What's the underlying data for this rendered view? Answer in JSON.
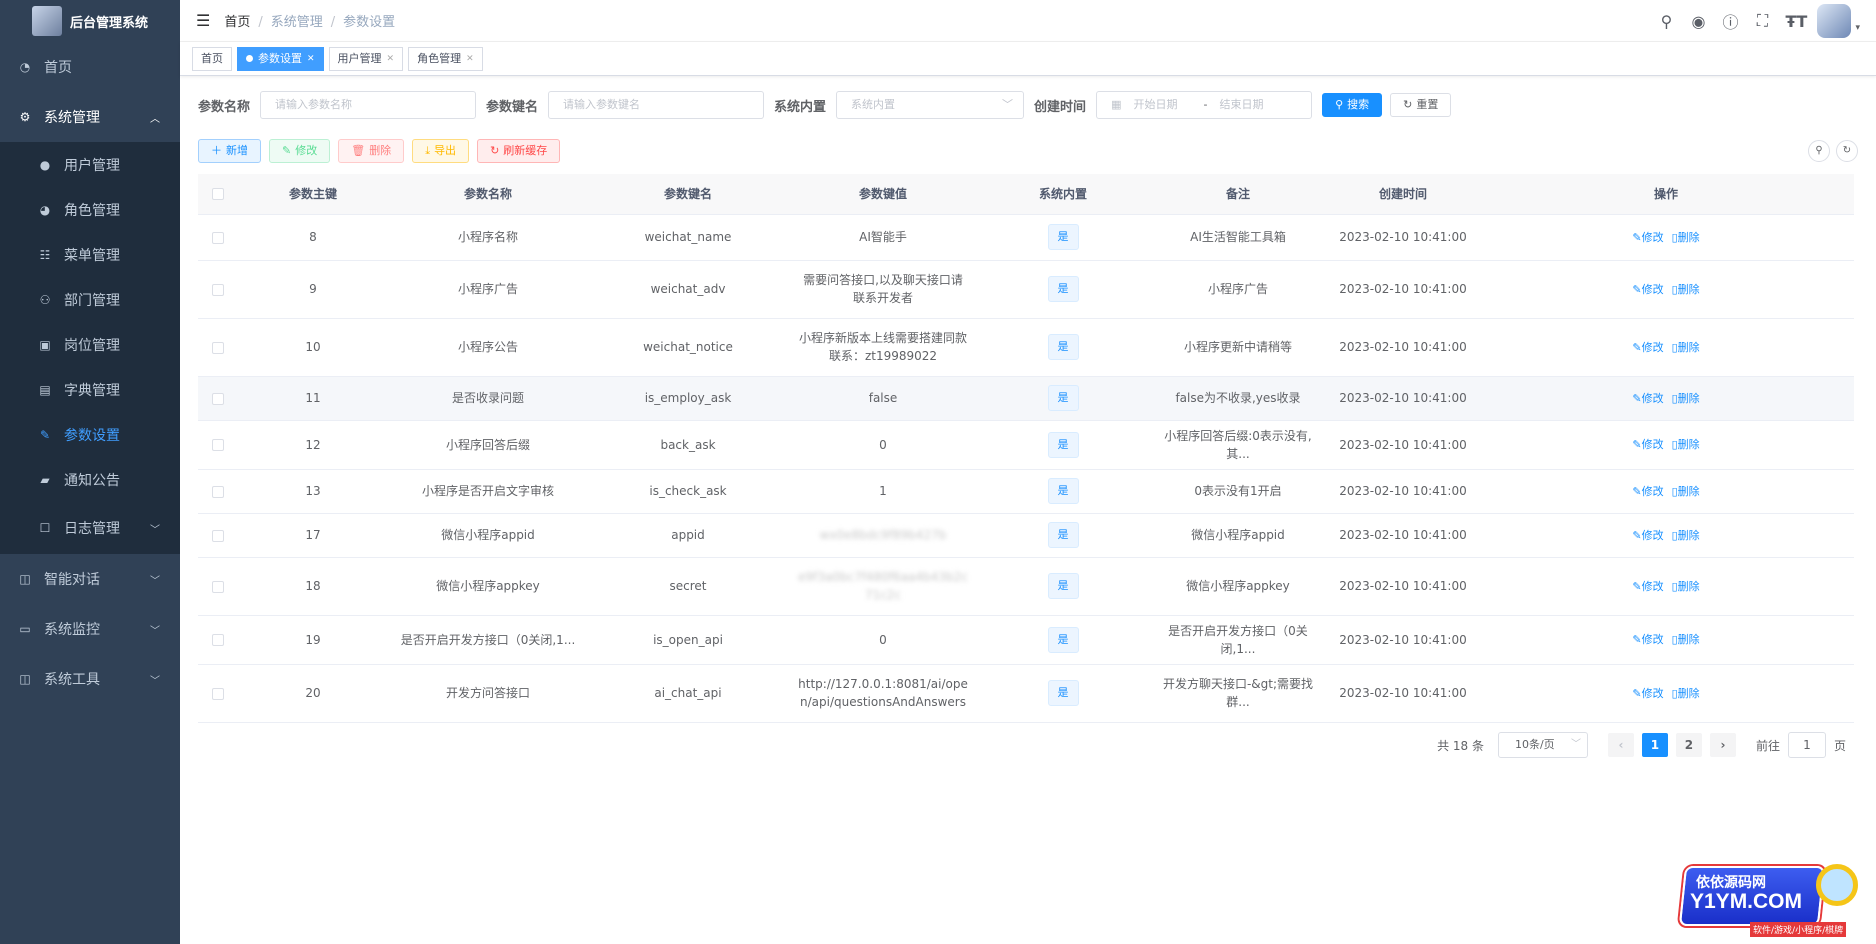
{
  "app": {
    "title": "后台管理系统"
  },
  "sidebar": {
    "items": [
      {
        "label": "首页",
        "icon": "dashboard-icon"
      },
      {
        "label": "系统管理",
        "icon": "gear-icon"
      },
      {
        "label": "用户管理",
        "icon": "user-icon"
      },
      {
        "label": "角色管理",
        "icon": "peoples-icon"
      },
      {
        "label": "菜单管理",
        "icon": "tree-table-icon"
      },
      {
        "label": "部门管理",
        "icon": "tree-icon"
      },
      {
        "label": "岗位管理",
        "icon": "post-icon"
      },
      {
        "label": "字典管理",
        "icon": "dict-icon"
      },
      {
        "label": "参数设置",
        "icon": "edit-icon"
      },
      {
        "label": "通知公告",
        "icon": "message-icon"
      },
      {
        "label": "日志管理",
        "icon": "log-icon"
      },
      {
        "label": "智能对话",
        "icon": "tool-icon"
      },
      {
        "label": "系统监控",
        "icon": "monitor-icon"
      },
      {
        "label": "系统工具",
        "icon": "tool-icon"
      }
    ]
  },
  "breadcrumb": [
    "首页",
    "系统管理",
    "参数设置"
  ],
  "tags": [
    "首页",
    "参数设置",
    "用户管理",
    "角色管理"
  ],
  "search": {
    "config_name_label": "参数名称",
    "config_name_placeholder": "请输入参数名称",
    "config_key_label": "参数键名",
    "config_key_placeholder": "请输入参数键名",
    "builtin_label": "系统内置",
    "builtin_placeholder": "系统内置",
    "created_label": "创建时间",
    "start_placeholder": "开始日期",
    "range_sep": "-",
    "end_placeholder": "结束日期",
    "search_button": "搜索",
    "reset_button": "重置"
  },
  "toolbar": {
    "add": "新增",
    "edit": "修改",
    "delete": "删除",
    "export": "导出",
    "refresh_cache": "刷新缓存"
  },
  "table": {
    "columns": [
      "参数主键",
      "参数名称",
      "参数键名",
      "参数键值",
      "系统内置",
      "备注",
      "创建时间",
      "操作"
    ],
    "rows": [
      {
        "id": "8",
        "name": "小程序名称",
        "key": "weichat_name",
        "value": "AI智能手",
        "builtin": "是",
        "remark": "AI生活智能工具箱",
        "created": "2023-02-10 10:41:00"
      },
      {
        "id": "9",
        "name": "小程序广告",
        "key": "weichat_adv",
        "value": "需要问答接口,以及聊天接口请联系开发者",
        "builtin": "是",
        "remark": "小程序广告",
        "created": "2023-02-10 10:41:00"
      },
      {
        "id": "10",
        "name": "小程序公告",
        "key": "weichat_notice",
        "value": "小程序新版本上线需要搭建同款联系：zt19989022",
        "builtin": "是",
        "remark": "小程序更新中请稍等",
        "created": "2023-02-10 10:41:00"
      },
      {
        "id": "11",
        "name": "是否收录问题",
        "key": "is_employ_ask",
        "value": "false",
        "builtin": "是",
        "remark": "false为不收录,yes收录",
        "created": "2023-02-10 10:41:00"
      },
      {
        "id": "12",
        "name": "小程序回答后缀",
        "key": "back_ask",
        "value": "0",
        "builtin": "是",
        "remark": "小程序回答后缀:0表示没有,其...",
        "created": "2023-02-10 10:41:00"
      },
      {
        "id": "13",
        "name": "小程序是否开启文字审核",
        "key": "is_check_ask",
        "value": "1",
        "builtin": "是",
        "remark": "0表示没有1开启",
        "created": "2023-02-10 10:41:00"
      },
      {
        "id": "17",
        "name": "微信小程序appid",
        "key": "appid",
        "value": "wx0e8bdc9f89b427b",
        "builtin": "是",
        "remark": "微信小程序appid",
        "created": "2023-02-10 10:41:00"
      },
      {
        "id": "18",
        "name": "微信小程序appkey",
        "key": "secret",
        "value": "e9f3a0bc7f480f6aa4b43b2c71c2c",
        "builtin": "是",
        "remark": "微信小程序appkey",
        "created": "2023-02-10 10:41:00"
      },
      {
        "id": "19",
        "name": "是否开启开发方接口（0关闭,1...",
        "key": "is_open_api",
        "value": "0",
        "builtin": "是",
        "remark": "是否开启开发方接口（0关闭,1...",
        "created": "2023-02-10 10:41:00"
      },
      {
        "id": "20",
        "name": "开发方问答接口",
        "key": "ai_chat_api",
        "value": "http://127.0.0.1:8081/ai/open/api/questionsAndAnswers",
        "builtin": "是",
        "remark": "开发方聊天接口-&gt;需要找群...",
        "created": "2023-02-10 10:41:00"
      }
    ],
    "edit_label": "修改",
    "delete_label": "删除"
  },
  "pagination": {
    "total": "共 18 条",
    "page_size": "10条/页",
    "pages": [
      "1",
      "2"
    ],
    "current_page": 1,
    "goto_label": "前往",
    "goto_value": "1",
    "page_suffix": "页"
  },
  "watermark": {
    "line1": "依依源码网",
    "line2": "Y1YM.COM",
    "line3": "软件/游戏/小程序/棋牌"
  },
  "colors": {
    "sidebar_bg": "#304156",
    "primary": "#1890ff",
    "active_menu": "#409eff"
  }
}
